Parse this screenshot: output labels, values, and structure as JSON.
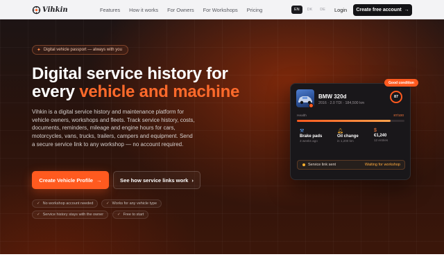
{
  "nav": {
    "logo_text": "Vihkin",
    "links": [
      "Features",
      "How it works",
      "For Owners",
      "For Workshops",
      "Pricing"
    ],
    "languages": [
      "EN",
      "DK",
      "DE"
    ],
    "active_language": "EN",
    "login": "Login",
    "cta": "Create free account",
    "cta_icon": "arrow-right-icon"
  },
  "hero": {
    "pill": "Digital vehicle passport — always with you",
    "pill_icon": "sparkle-icon",
    "title_line1": "Digital service history for",
    "title_word1": "every",
    "title_word2": "vehicle",
    "title_word3": "and",
    "title_word4": "machine",
    "description": "Vihkin is a digital service history and maintenance platform for vehicle owners, workshops and fleets. Track service history, costs, documents, reminders, mileage and engine hours for cars, motorcycles, vans, trucks, trailers, campers and equipment. Send a secure service link to any workshop — no account required.",
    "primary_button": "Create Vehicle Profile",
    "secondary_button": "See how service links work",
    "checks": [
      "No workshop account needed",
      "Works for any vehicle type",
      "Service history stays with the owner",
      "Free to start"
    ]
  },
  "card": {
    "badge": "Good condition",
    "vehicle_name": "BMW 320d",
    "vehicle_details": "2016 · 2.0 TDI · 184,500 km",
    "score": "87",
    "health_label": "Health",
    "health_value": "87/100",
    "health_fraction": 0.87,
    "stats": [
      {
        "icon": "wrench-icon",
        "title": "Brake pads",
        "sub": "3 weeks ago"
      },
      {
        "icon": "bell-icon",
        "title": "Oil change",
        "sub": "in 1,200 km"
      },
      {
        "icon": "dollar-icon",
        "title": "€1,240",
        "sub": "12 entries"
      }
    ],
    "link_label": "Service link sent",
    "link_status": "Waiting for workshop"
  },
  "colors": {
    "accent": "#ff5a1f",
    "warning": "#ffab3f",
    "dark": "#131316"
  }
}
